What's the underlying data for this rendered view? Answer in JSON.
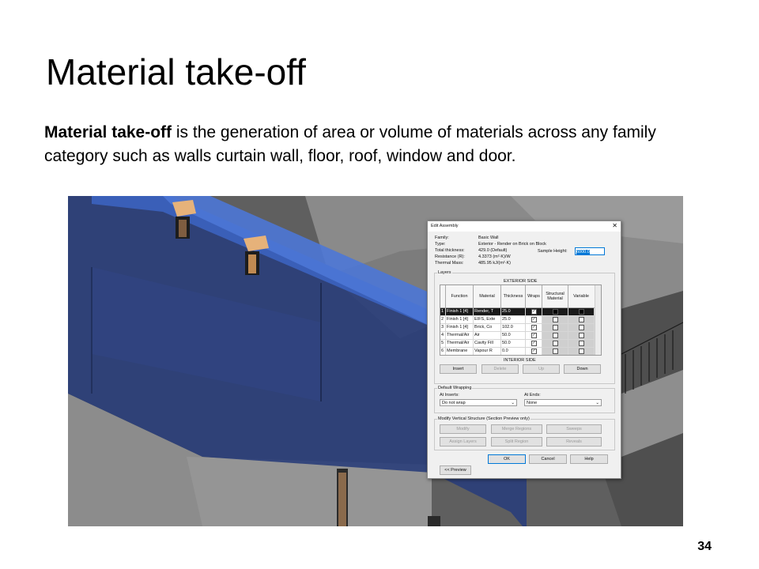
{
  "slide": {
    "title": "Material take-off",
    "body_bold": "Material take-off",
    "body_rest": " is the generation of area or volume of materials across any family category such as walls curtain wall, floor, roof, window and door.",
    "page_number": "34"
  },
  "dialog": {
    "title": "Edit Assembly",
    "close": "✕",
    "props": [
      {
        "label": "Family:",
        "value": "Basic Wall"
      },
      {
        "label": "Type:",
        "value": "Exterior - Render on Brick on Block"
      },
      {
        "label": "Total thickness:",
        "value": "429.0 (Default)"
      },
      {
        "label": "Resistance (R):",
        "value": "4.3373 (m²·K)/W"
      },
      {
        "label": "Thermal Mass:",
        "value": "485.95 kJ/(m²·K)"
      }
    ],
    "sample_height_label": "Sample Height:",
    "sample_height_value": "6000.0",
    "layers_label": "Layers",
    "exterior_side": "EXTERIOR SIDE",
    "interior_side": "INTERIOR SIDE",
    "columns": [
      "",
      "Function",
      "Material",
      "Thickness",
      "Wraps",
      "Structural Material",
      "Variable"
    ],
    "rows": [
      {
        "num": "1",
        "function": "Finish 1 [4]",
        "material": "Render, T",
        "thickness": "25.0",
        "wraps": "check",
        "structural": "black",
        "variable": "black"
      },
      {
        "num": "2",
        "function": "Finish 1 [4]",
        "material": "EIFS, Exte",
        "thickness": "25.0",
        "wraps": "check",
        "structural": "box",
        "variable": "box"
      },
      {
        "num": "3",
        "function": "Finish 1 [4]",
        "material": "Brick, Co",
        "thickness": "102.0",
        "wraps": "check",
        "structural": "box",
        "variable": "box"
      },
      {
        "num": "4",
        "function": "Thermal/Air",
        "material": "Air",
        "thickness": "50.0",
        "wraps": "check",
        "structural": "box",
        "variable": "box"
      },
      {
        "num": "5",
        "function": "Thermal/Air",
        "material": "Cavity Fill",
        "thickness": "50.0",
        "wraps": "check",
        "structural": "box",
        "variable": "box"
      },
      {
        "num": "6",
        "function": "Membrane",
        "material": "Vapour R",
        "thickness": "0.0",
        "wraps": "check",
        "structural": "box",
        "variable": "box"
      }
    ],
    "buttons_layers": [
      "Insert",
      "Delete",
      "Up",
      "Down"
    ],
    "default_wrapping_label": "Default Wrapping",
    "at_inserts_label": "At Inserts:",
    "at_inserts_value": "Do not wrap",
    "at_ends_label": "At Ends:",
    "at_ends_value": "None",
    "modify_label": "Modify Vertical Structure (Section Preview only)",
    "modify_buttons": [
      "Modify",
      "Merge Regions",
      "Sweeps",
      "Assign Layers",
      "Split Region",
      "Reveals"
    ],
    "ok": "OK",
    "cancel": "Cancel",
    "help": "Help",
    "preview": "<< Preview",
    "chevron": "⌄"
  }
}
